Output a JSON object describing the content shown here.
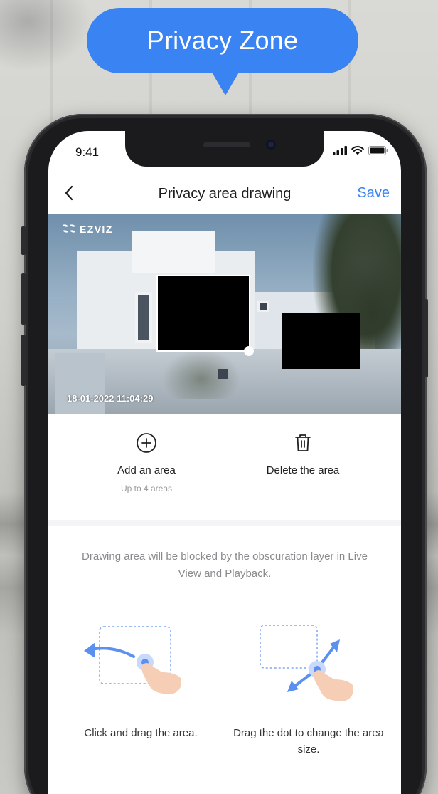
{
  "banner": {
    "title": "Privacy Zone"
  },
  "status_bar": {
    "time": "9:41"
  },
  "nav": {
    "title": "Privacy area drawing",
    "save_label": "Save"
  },
  "live_view": {
    "brand": "EZVIZ",
    "timestamp": "18-01-2022 11:04:29"
  },
  "actions": {
    "add": {
      "label": "Add an area",
      "sub": "Up to 4 areas"
    },
    "delete": {
      "label": "Delete the area"
    }
  },
  "hint": "Drawing area will be blocked by the obscuration layer in Live View and Playback.",
  "tips": [
    {
      "label": "Click and drag the area."
    },
    {
      "label": "Drag the dot to change the area size."
    }
  ],
  "colors": {
    "accent": "#3a83f2",
    "mask": "#000000"
  },
  "icons": [
    "back-chevron-icon",
    "plus-circle-icon",
    "trash-icon",
    "signal-icon",
    "wifi-icon",
    "battery-icon",
    "ezviz-logo-icon",
    "hand-pointer-icon",
    "arrow-icon"
  ]
}
